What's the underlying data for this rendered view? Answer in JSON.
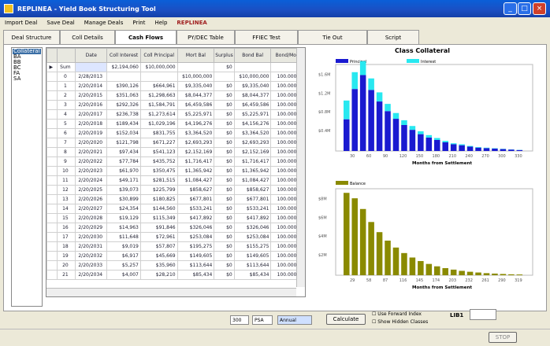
{
  "window": {
    "title": "REPLINEA - Yield Book Structuring Tool"
  },
  "menu": [
    "Import Deal",
    "Save Deal",
    "Manage Deals",
    "Print",
    "Help"
  ],
  "menu_brand": "REPLINEA",
  "tabs": [
    "Deal Structure",
    "Coll Details",
    "Cash Flows",
    "PY/DEC Table",
    "FFIEC Test",
    "Tie Out",
    "Script"
  ],
  "classes": [
    "Collateral",
    "BA",
    "BB",
    "BC",
    "FA",
    "SA"
  ],
  "table": {
    "headers": [
      "",
      "Date",
      "Coll Interest",
      "Coll Principal",
      "Mort Bal",
      "Surplus",
      "Bond Bal",
      "Bond/Mort"
    ],
    "rows": [
      [
        "Sum",
        "",
        "$2,194,060",
        "$10,000,000",
        "",
        "$0",
        "",
        ""
      ],
      [
        "0",
        "2/28/2013",
        "",
        "",
        "$10,000,000",
        "",
        "$10,000,000",
        "100.000 %"
      ],
      [
        "1",
        "2/20/2014",
        "$390,126",
        "$664,961",
        "$9,335,040",
        "$0",
        "$9,335,040",
        "100.000 %"
      ],
      [
        "2",
        "2/20/2015",
        "$351,063",
        "$1,298,663",
        "$8,044,377",
        "$0",
        "$8,044,377",
        "100.000 %"
      ],
      [
        "3",
        "2/20/2016",
        "$292,326",
        "$1,584,791",
        "$6,459,586",
        "$0",
        "$6,459,586",
        "100.000 %"
      ],
      [
        "4",
        "2/20/2017",
        "$236,738",
        "$1,273,614",
        "$5,225,971",
        "$0",
        "$5,225,971",
        "100.000 %"
      ],
      [
        "5",
        "2/20/2018",
        "$189,434",
        "$1,029,196",
        "$4,196,276",
        "$0",
        "$4,156,276",
        "100.000 %"
      ],
      [
        "6",
        "2/20/2019",
        "$152,034",
        "$831,755",
        "$3,364,520",
        "$0",
        "$3,364,520",
        "100.000 %"
      ],
      [
        "7",
        "2/20/2020",
        "$121,798",
        "$671,227",
        "$2,693,293",
        "$0",
        "$2,693,293",
        "100.000 %"
      ],
      [
        "8",
        "2/20/2021",
        "$97,434",
        "$541,123",
        "$2,152,169",
        "$0",
        "$2,152,169",
        "100.000 %"
      ],
      [
        "9",
        "2/20/2022",
        "$77,784",
        "$435,752",
        "$1,716,417",
        "$0",
        "$1,716,417",
        "100.000 %"
      ],
      [
        "10",
        "2/20/2023",
        "$61,970",
        "$350,475",
        "$1,365,942",
        "$0",
        "$1,365,942",
        "100.000 %"
      ],
      [
        "11",
        "2/20/2024",
        "$49,171",
        "$281,515",
        "$1,084,427",
        "$0",
        "$1,084,427",
        "100.000 %"
      ],
      [
        "12",
        "2/20/2025",
        "$39,073",
        "$225,799",
        "$858,627",
        "$0",
        "$858,627",
        "100.000 %"
      ],
      [
        "13",
        "2/20/2026",
        "$30,899",
        "$180,825",
        "$677,801",
        "$0",
        "$677,801",
        "100.000 %"
      ],
      [
        "14",
        "2/20/2027",
        "$24,354",
        "$144,560",
        "$533,241",
        "$0",
        "$533,241",
        "100.000 %"
      ],
      [
        "15",
        "2/20/2028",
        "$19,129",
        "$115,349",
        "$417,892",
        "$0",
        "$417,892",
        "100.000 %"
      ],
      [
        "16",
        "2/20/2029",
        "$14,963",
        "$91,846",
        "$326,046",
        "$0",
        "$326,046",
        "100.000 %"
      ],
      [
        "17",
        "2/20/2030",
        "$11,648",
        "$72,961",
        "$253,084",
        "$0",
        "$253,084",
        "100.000 %"
      ],
      [
        "18",
        "2/20/2031",
        "$9,019",
        "$57,807",
        "$195,275",
        "$0",
        "$155,275",
        "100.000 %"
      ],
      [
        "19",
        "2/20/2032",
        "$6,917",
        "$45,669",
        "$149,605",
        "$0",
        "$149,605",
        "100.000 %"
      ],
      [
        "20",
        "2/20/2033",
        "$5,257",
        "$35,960",
        "$113,644",
        "$0",
        "$113,644",
        "100.000 %"
      ],
      [
        "21",
        "2/20/2034",
        "$4,007",
        "$28,210",
        "$85,434",
        "$0",
        "$85,434",
        "100.000 %"
      ]
    ]
  },
  "charts": {
    "title": "Class Collateral",
    "legend_principal": "Principal",
    "legend_interest": "Interest",
    "legend_balance": "Balance",
    "xlabel": "Months from Settlement"
  },
  "chart_data": [
    {
      "type": "bar",
      "title": "Class Collateral",
      "series": [
        {
          "name": "Principal",
          "color": "#1a1ad0",
          "values": [
            0.66,
            1.29,
            1.58,
            1.27,
            1.03,
            0.83,
            0.67,
            0.54,
            0.44,
            0.35,
            0.28,
            0.23,
            0.18,
            0.14,
            0.12,
            0.09,
            0.07,
            0.06,
            0.05,
            0.04,
            0.03,
            0.02
          ]
        },
        {
          "name": "Interest",
          "color": "#28e8f0",
          "values": [
            0.39,
            0.35,
            0.29,
            0.24,
            0.19,
            0.15,
            0.12,
            0.1,
            0.08,
            0.06,
            0.05,
            0.04,
            0.03,
            0.02,
            0.02,
            0.015,
            0.012,
            0.009,
            0.007,
            0.005,
            0.004,
            0.003
          ]
        }
      ],
      "yticks": [
        "$0.4M",
        "$0.8M",
        "$1.2M",
        "$1.6M"
      ],
      "xticks": [
        "30",
        "60",
        "90",
        "120",
        "150",
        "180",
        "210",
        "240",
        "270",
        "300",
        "330"
      ],
      "xlabel": "Months from Settlement"
    },
    {
      "type": "bar",
      "series": [
        {
          "name": "Balance",
          "color": "#8a8a00",
          "values": [
            10,
            9.34,
            8.04,
            6.46,
            5.23,
            4.2,
            3.36,
            2.69,
            2.15,
            1.72,
            1.37,
            1.08,
            0.86,
            0.68,
            0.53,
            0.42,
            0.33,
            0.25,
            0.2,
            0.15,
            0.11,
            0.09
          ]
        }
      ],
      "yticks": [
        "$2M",
        "$4M",
        "$6M",
        "$8M"
      ],
      "xticks": [
        "29",
        "58",
        "87",
        "116",
        "145",
        "174",
        "203",
        "232",
        "261",
        "290",
        "319"
      ],
      "xlabel": "Months from Settlement"
    }
  ],
  "controls": {
    "speed": "300",
    "speed_unit": "PSA",
    "freq": "Annual",
    "calculate": "Calculate",
    "use_forward": "Use Forward Index",
    "show_hidden": "Show Hidden Classes",
    "libor_label": "L\u0000IB1",
    "stop": "STOP"
  }
}
